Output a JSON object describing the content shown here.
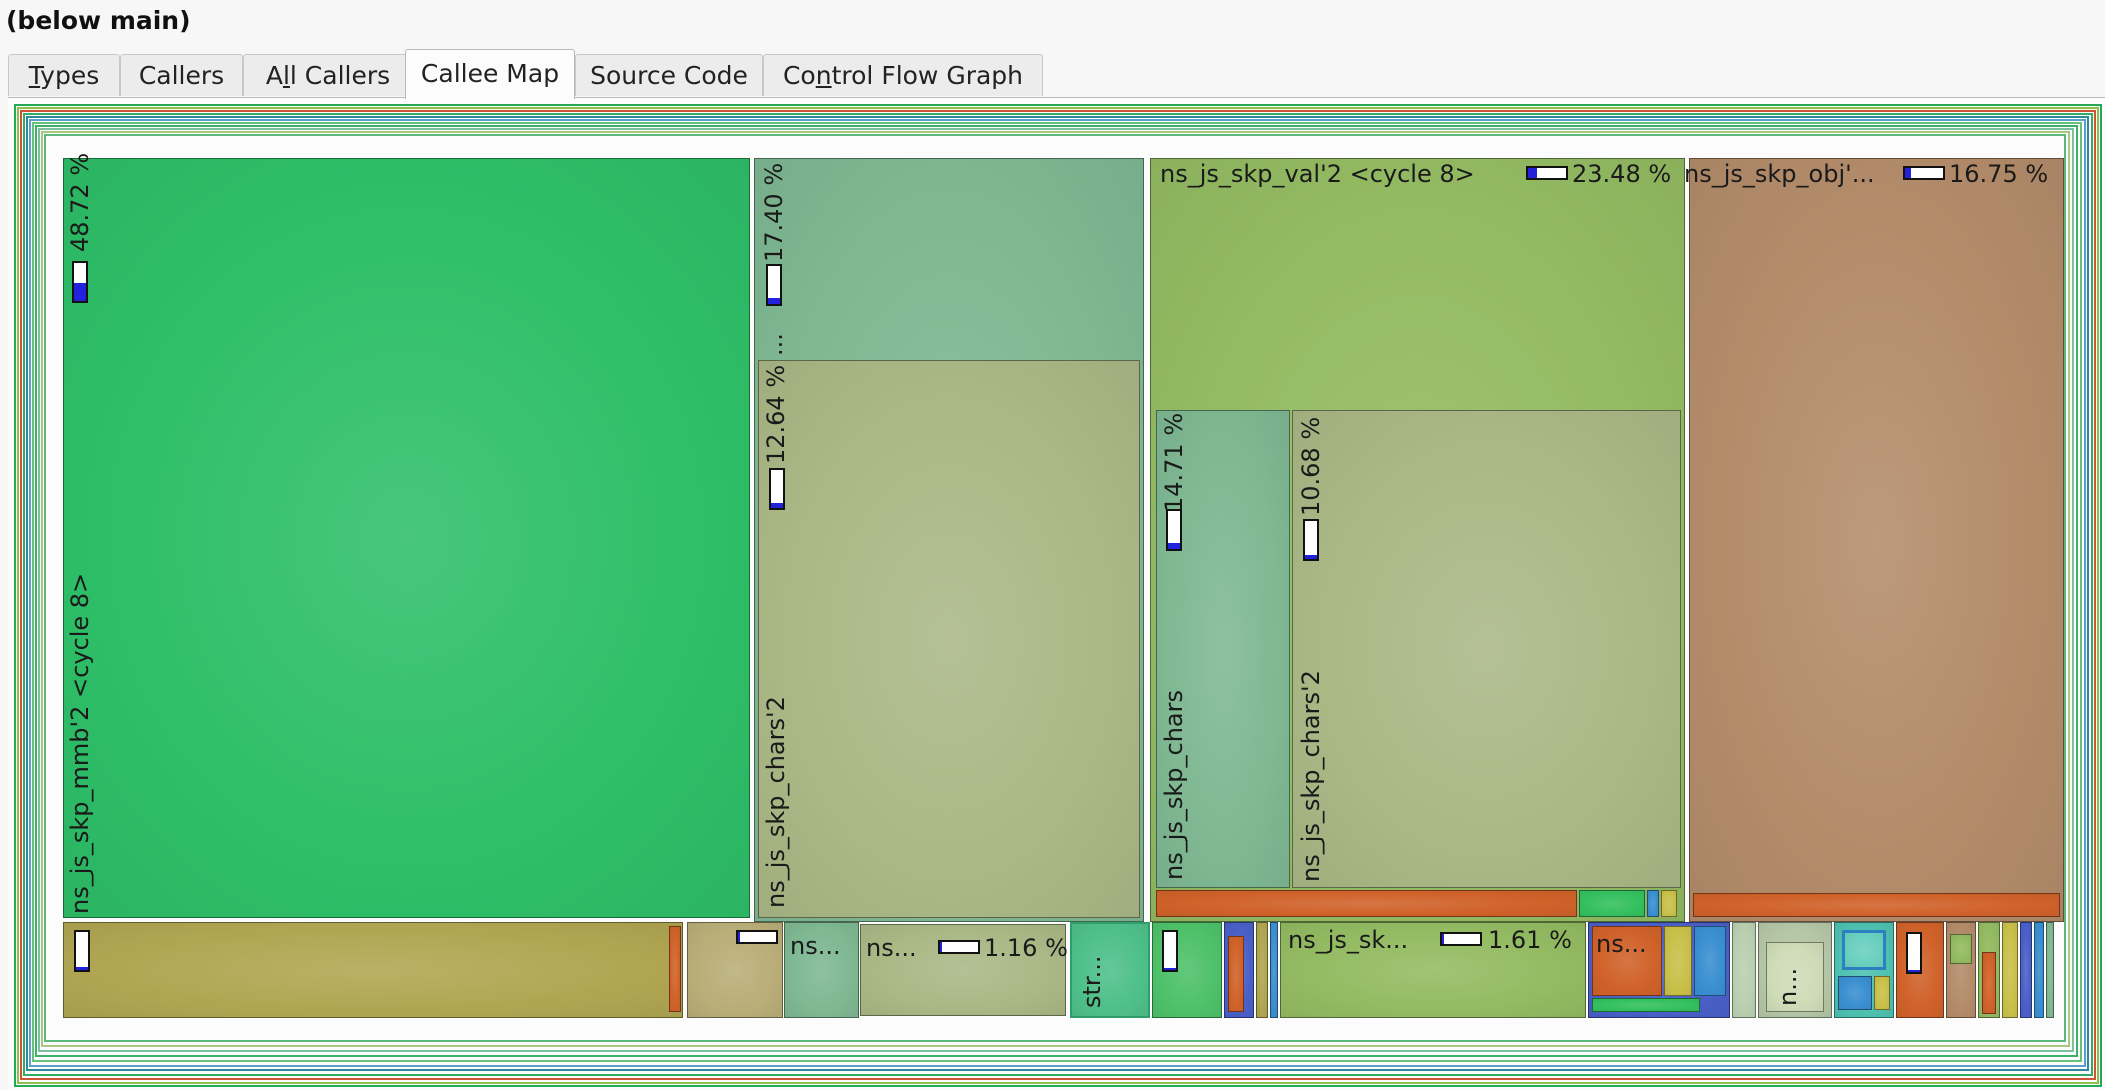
{
  "window_title": "(below main)",
  "tabs": [
    {
      "prefix": "",
      "mnemonic": "T",
      "rest": "ypes"
    },
    {
      "prefix": "Callers",
      "mnemonic": "",
      "rest": ""
    },
    {
      "prefix": "A",
      "mnemonic": "l",
      "rest": "l Callers"
    },
    {
      "prefix": "Callee Map",
      "mnemonic": "",
      "rest": ""
    },
    {
      "prefix": "Source Code",
      "mnemonic": "",
      "rest": ""
    },
    {
      "prefix": "Co",
      "mnemonic": "n",
      "rest": "trol Flow Graph"
    }
  ],
  "active_tab": "Callee Map",
  "treemap": {
    "mmb": {
      "name": "ns_js_skp_mmb'2 <cycle 8>",
      "percent": "48.72 %",
      "fill": 0.48
    },
    "block_top": {
      "percent": "17.40 %",
      "ellipsis": "...",
      "fill": 0.17
    },
    "chars_a": {
      "name": "ns_js_skp_chars'2",
      "percent": "12.64 %",
      "fill": 0.13
    },
    "val": {
      "name": "ns_js_skp_val'2 <cycle 8>",
      "percent": "23.48 %",
      "fill": 0.23
    },
    "chars_b": {
      "name": "ns_js_skp_chars",
      "percent": "14.71 %",
      "fill": 0.15
    },
    "chars_c": {
      "name": "ns_js_skp_chars'2",
      "percent": "10.68 %",
      "fill": 0.11
    },
    "obj": {
      "name": "ns_js_skp_obj'...",
      "percent": "16.75 %",
      "fill": 0.17
    },
    "small_ns1": {
      "name": "ns..."
    },
    "small_ns2": {
      "name": "ns...",
      "percent": "1.16 %",
      "fill": 0.03
    },
    "small_str": {
      "name": "str..."
    },
    "small_sk": {
      "name": "ns_js_sk...",
      "percent": "1.61 %",
      "fill": 0.03
    },
    "small_ns3": {
      "name": "ns..."
    },
    "small_n": {
      "name": "n..."
    }
  },
  "colors": {
    "green_main": "#2ebf68",
    "green_teal": "#7fb893",
    "khaki": "#aab886",
    "olive_green": "#93bb62",
    "brown": "#b38c6a",
    "mustard": "#b0a652",
    "orange": "#d0622a",
    "bar_blue": "#2222dd"
  }
}
